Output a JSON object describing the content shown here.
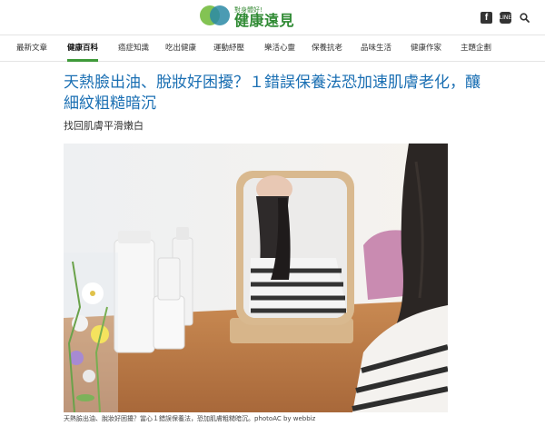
{
  "site": {
    "logo_sub": "對身體好!",
    "logo_main": "健康遠見",
    "icons": [
      "facebook-icon",
      "line-icon",
      "search-icon"
    ]
  },
  "nav": {
    "items": [
      {
        "label": "最新文章",
        "active": false
      },
      {
        "label": "健康百科",
        "active": true
      },
      {
        "label": "癌症知識",
        "active": false
      },
      {
        "label": "吃出健康",
        "active": false
      },
      {
        "label": "運動紓壓",
        "active": false
      },
      {
        "label": "樂活心靈",
        "active": false
      },
      {
        "label": "保養抗老",
        "active": false
      },
      {
        "label": "品味生活",
        "active": false
      },
      {
        "label": "健康作家",
        "active": false
      },
      {
        "label": "主題企劃",
        "active": false
      }
    ]
  },
  "article": {
    "title": "天熱臉出油、脫妝好困擾？１錯誤保養法恐加速肌膚老化，釀細紋粗糙暗沉",
    "subtitle": "找回肌膚平滑嫩白",
    "image_caption": "天熱臉出油、脫妝好困擾？當心１錯誤保養法，恐加肌膚粗糙暗沉。photoAC by webbiz"
  }
}
